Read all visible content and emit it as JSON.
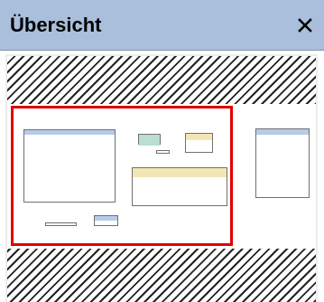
{
  "panel": {
    "title": "Übersicht",
    "close_label": "×"
  },
  "colors": {
    "titlebar": "#a9bfdc",
    "viewport_border": "#e00000",
    "hatch": "#222222"
  },
  "icons": {
    "close": "close-icon"
  }
}
